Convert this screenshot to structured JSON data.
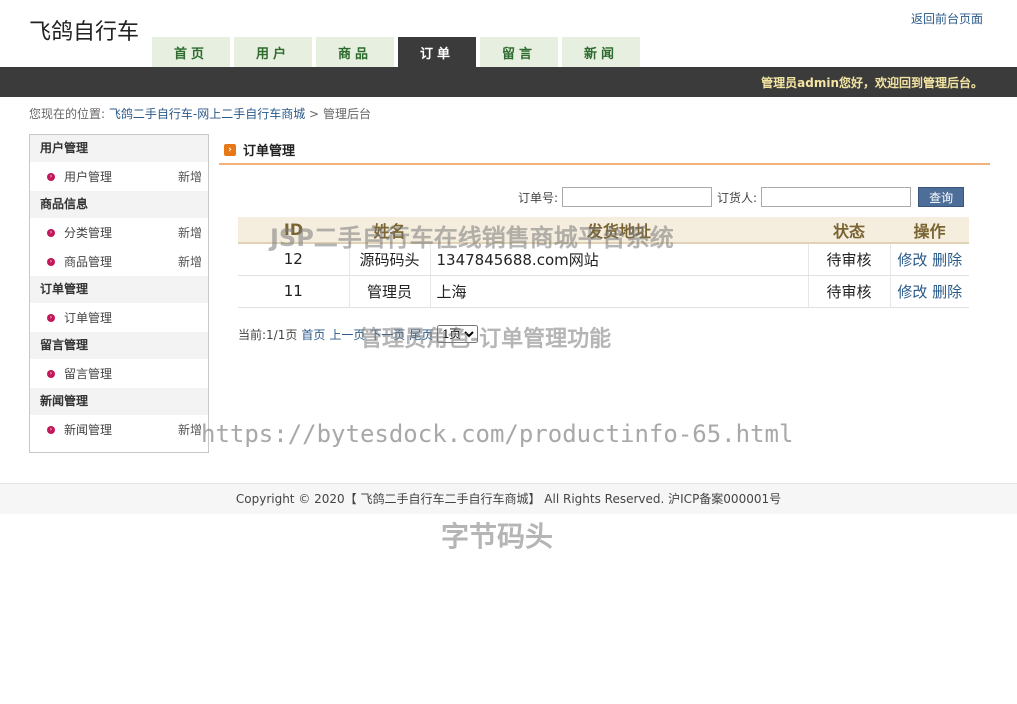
{
  "header": {
    "site_title": "飞鸽自行车",
    "back_link": "返回前台页面",
    "welcome": "管理员admin您好，欢迎回到管理后台。"
  },
  "nav": {
    "tabs": [
      {
        "label": "首页"
      },
      {
        "label": "用户"
      },
      {
        "label": "商品"
      },
      {
        "label": "订单"
      },
      {
        "label": "留言"
      },
      {
        "label": "新闻"
      }
    ],
    "active_index": 3
  },
  "breadcrumb": {
    "prefix": "您现在的位置:",
    "site": "飞鸽二手自行车-网上二手自行车商城",
    "sep": ">",
    "current": "管理后台"
  },
  "sidebar": {
    "groups": [
      {
        "title": "用户管理",
        "items": [
          {
            "label": "用户管理",
            "add": "新增"
          }
        ]
      },
      {
        "title": "商品信息",
        "items": [
          {
            "label": "分类管理",
            "add": "新增"
          },
          {
            "label": "商品管理",
            "add": "新增"
          }
        ]
      },
      {
        "title": "订单管理",
        "items": [
          {
            "label": "订单管理",
            "add": ""
          }
        ]
      },
      {
        "title": "留言管理",
        "items": [
          {
            "label": "留言管理",
            "add": ""
          }
        ]
      },
      {
        "title": "新闻管理",
        "items": [
          {
            "label": "新闻管理",
            "add": "新增"
          }
        ]
      }
    ]
  },
  "panel": {
    "title": "订单管理"
  },
  "search": {
    "order_no_label": "订单号:",
    "orderer_label": "订货人:",
    "button": "查询"
  },
  "table": {
    "headers": [
      "ID",
      "姓名",
      "发货地址",
      "状态",
      "操作"
    ],
    "rows": [
      {
        "id": "12",
        "name": "源码码头",
        "address": "1347845688.com网站",
        "status": "待审核",
        "edit": "修改",
        "del": "删除"
      },
      {
        "id": "11",
        "name": "管理员",
        "address": "上海",
        "status": "待审核",
        "edit": "修改",
        "del": "删除"
      }
    ]
  },
  "pager": {
    "current": "当前:1/1页",
    "first": "首页",
    "prev": "上一页",
    "next": "下一页",
    "last": "尾页",
    "select_value": "1页"
  },
  "watermarks": {
    "title": "JSP二手自行车在线销售商城平台系统",
    "subtitle": "管理员角色-订单管理功能",
    "url": "https://bytesdock.com/productinfo-65.html",
    "brand": "字节码头"
  },
  "footer": {
    "text": "Copyright © 2020【 飞鸽二手自行车二手自行车商城】 All Rights Reserved. 沪ICP备案000001号"
  }
}
